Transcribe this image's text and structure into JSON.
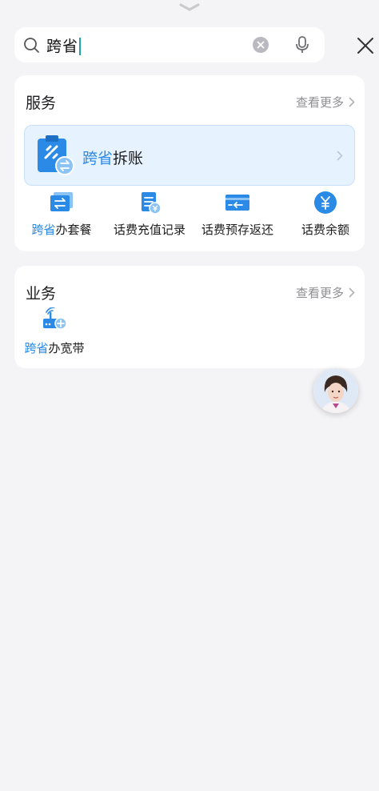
{
  "search": {
    "query": "跨省"
  },
  "services": {
    "title": "服务",
    "more": "查看更多",
    "banner": {
      "highlight": "跨省",
      "rest": "拆账"
    },
    "items": [
      {
        "highlight": "跨省",
        "rest": "办套餐",
        "icon": "package-swap-icon"
      },
      {
        "highlight": "",
        "rest": "话费充值记录",
        "icon": "recharge-record-icon"
      },
      {
        "highlight": "",
        "rest": "话费预存返还",
        "icon": "prepay-refund-card-icon"
      },
      {
        "highlight": "",
        "rest": "话费余额",
        "icon": "yuan-balance-icon"
      }
    ]
  },
  "business": {
    "title": "业务",
    "more": "查看更多",
    "items": [
      {
        "highlight": "跨省",
        "rest": "办宽带",
        "icon": "broadband-router-icon"
      }
    ]
  },
  "colors": {
    "accent": "#2a8ae6",
    "banner_bg": "#e6f2fe",
    "page_bg": "#f4f4f6"
  }
}
